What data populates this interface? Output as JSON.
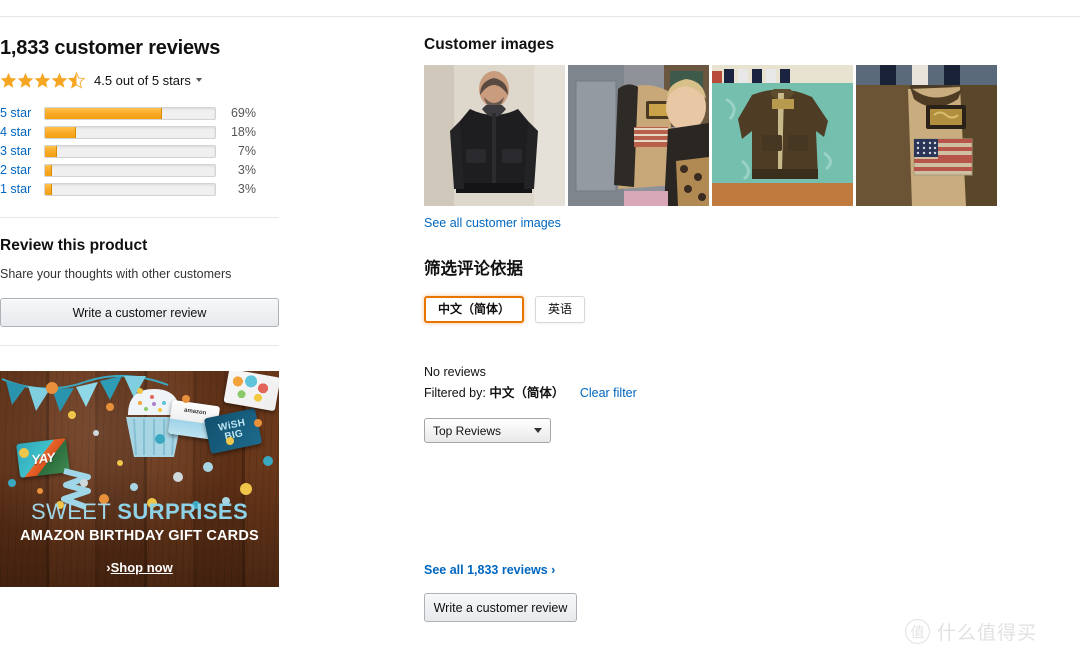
{
  "left": {
    "reviews_title": "1,833 customer reviews",
    "rating_text": "4.5 out of 5 stars",
    "rating_value": 4.5,
    "histogram": [
      {
        "label": "5 star",
        "pct": "69%",
        "value": 69
      },
      {
        "label": "4 star",
        "pct": "18%",
        "value": 18
      },
      {
        "label": "3 star",
        "pct": "7%",
        "value": 7
      },
      {
        "label": "2 star",
        "pct": "3%",
        "value": 3
      },
      {
        "label": "1 star",
        "pct": "3%",
        "value": 3
      }
    ],
    "review_product_title": "Review this product",
    "review_product_sub": "Share your thoughts with other customers",
    "write_review_label": "Write a customer review"
  },
  "ad": {
    "line1_word1": "SWEET",
    "line1_word2": "SURPRISES",
    "line2": "AMAZON BIRTHDAY GIFT CARDS",
    "cta_arrow": "›",
    "cta_label": "Shop now",
    "card_yay": "YAY",
    "card_amazon": "amazon",
    "card_wish_1": "WiSH",
    "card_wish_2": "BIG"
  },
  "right": {
    "customer_images_title": "Customer images",
    "images": [
      {
        "alt": "man wearing black leather bomber jacket"
      },
      {
        "alt": "woman holding open tan-lined leather jacket"
      },
      {
        "alt": "brown leather flight jacket on bed"
      },
      {
        "alt": "jacket interior lining with american flag patch"
      }
    ],
    "see_all_images": "See all customer images",
    "filter_title": "筛选评论依据",
    "lang_buttons": [
      {
        "label": "中文（简体）",
        "selected": true
      },
      {
        "label": "英语",
        "selected": false
      }
    ],
    "no_reviews": "No reviews",
    "filtered_by_label": "Filtered by:",
    "filtered_by_value": "中文（简体）",
    "clear_filter": "Clear filter",
    "sort_value": "Top Reviews",
    "see_all_reviews": "See all 1,833 reviews ›",
    "write_review_label": "Write a customer review"
  },
  "watermark": {
    "mark": "值",
    "text": "什么值得买"
  },
  "colors": {
    "link": "#0066c0",
    "star": "#f5a623",
    "bar": "#f9a825",
    "selected_border": "#e77600"
  }
}
